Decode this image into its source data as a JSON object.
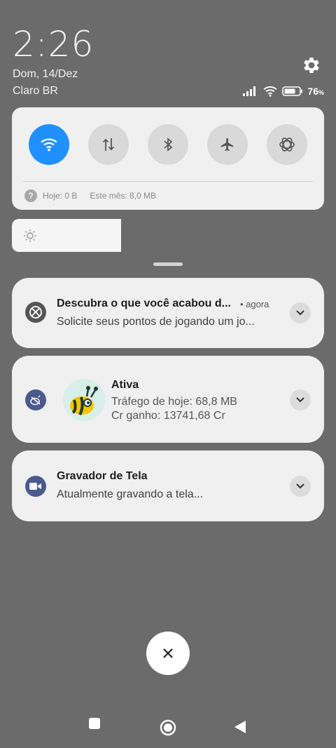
{
  "status": {
    "time": "2:26",
    "date": "Dom, 14/Dez",
    "carrier": "Claro BR",
    "battery_percent": "76",
    "battery_unit": "%"
  },
  "quick_settings": {
    "toggles": [
      {
        "name": "wifi",
        "icon": "wifi-icon",
        "active": true
      },
      {
        "name": "mobile-data",
        "icon": "data-arrows-icon",
        "active": false
      },
      {
        "name": "bluetooth",
        "icon": "bluetooth-icon",
        "active": false
      },
      {
        "name": "airplane-mode",
        "icon": "airplane-icon",
        "active": false
      },
      {
        "name": "openai-app",
        "icon": "openai-icon",
        "active": false
      }
    ],
    "data_usage": {
      "today": "Hoje: 0 B",
      "month": "Este mês: 8,0 MB"
    }
  },
  "brightness": {
    "level": 0.35
  },
  "notifications": [
    {
      "app_icon": "xbox-icon",
      "title": "Descubra o que você acabou d...",
      "time": "• agora",
      "text": "Solicite seus pontos de jogando um jo..."
    },
    {
      "app_icon": "bee-app-icon",
      "title": "Ativa",
      "line1": "Tráfego de hoje: 68,8 MB",
      "line2": "Cr ganho: 13741,68 Cr"
    },
    {
      "app_icon": "video-camera-icon",
      "title": "Gravador de Tela",
      "text": "Atualmente gravando a tela..."
    }
  ],
  "colors": {
    "background": "#6b6b6b",
    "card": "#f0f0f0",
    "accent": "#1e90ff",
    "icon_dark": "#4a5a8f"
  }
}
